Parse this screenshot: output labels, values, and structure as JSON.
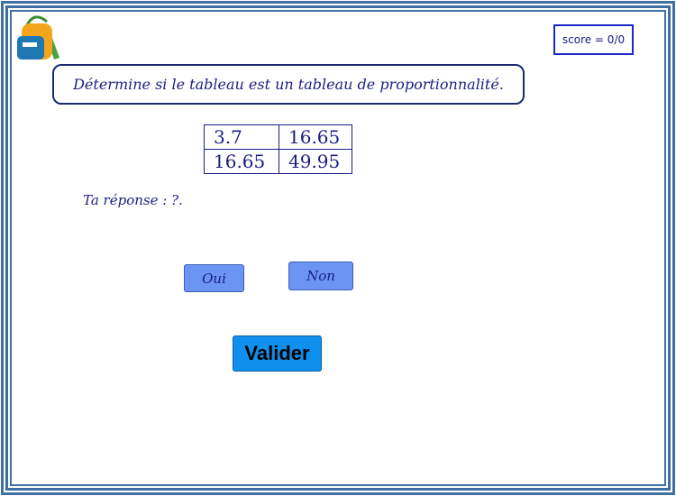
{
  "score": {
    "label": "score = 0/0"
  },
  "instruction": "Détermine si le tableau est un tableau de proportionnalité.",
  "table": {
    "rows": [
      [
        "3.7",
        "16.65"
      ],
      [
        "16.65",
        "49.95"
      ]
    ]
  },
  "answer": {
    "text": "Ta réponse :  ?."
  },
  "choices": {
    "yes": "Oui",
    "no": "Non"
  },
  "submit_label": "Valider",
  "colors": {
    "frame": "#3f6fa3",
    "text": "#1a1f80",
    "choice_button": "#6b94f3",
    "submit_button": "#0f90ee"
  },
  "icons": {
    "logo": "backpack-icon"
  }
}
